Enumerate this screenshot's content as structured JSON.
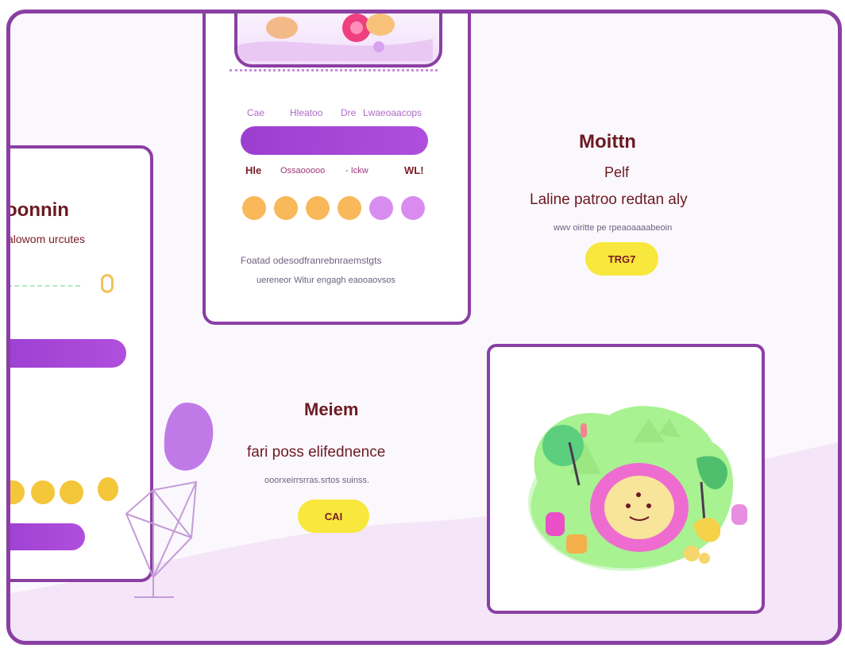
{
  "left_card": {
    "title": "oonnin",
    "subtitle": "alowom  urcutes",
    "badge": "0"
  },
  "top_card": {
    "nav_links": [
      "Cae",
      "Hleatoo",
      "Dre",
      "Lwaeoaacops"
    ],
    "labels": [
      "Hle",
      "Ossaooooo",
      "- Ickw",
      "WL!"
    ],
    "dot_colors": [
      "#f9b85a",
      "#f9b85a",
      "#f9b85a",
      "#f9b85a",
      "#d98cf0",
      "#d98cf0"
    ],
    "body_line1": "Foatad odesodfranrebnraemstgts",
    "body_line2": "uereneor Witur engagh eaooaovsos"
  },
  "right_text": {
    "title": "Moittn",
    "line1": "Pelf",
    "line2": "Laline patroo redtan aly",
    "caption": "wwv oiritte  pe rpeaoaaaabeoin",
    "button": "TRG7"
  },
  "center_text": {
    "title": "Meiem",
    "line1": "fari  poss elifednence",
    "caption": "ooorxeirrsrras.srtos  suinss.",
    "button": "CAI"
  },
  "colors": {
    "frame": "#8a3fa3",
    "accent_purple": "#9b3ed0",
    "button_yellow": "#f8e73c",
    "heading_dark": "#6b1a22"
  }
}
